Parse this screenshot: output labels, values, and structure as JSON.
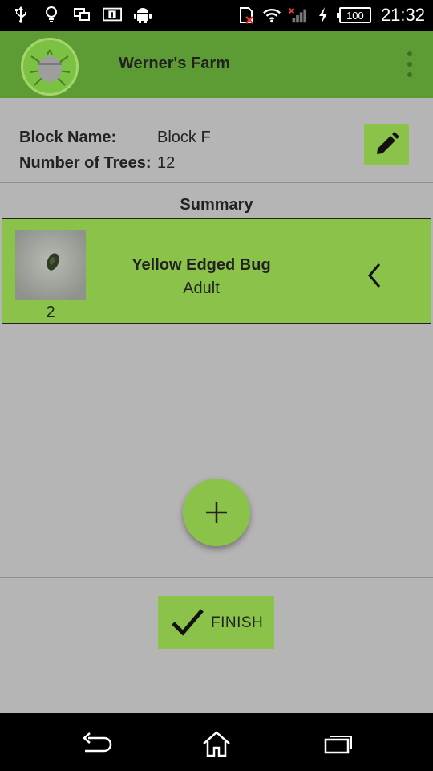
{
  "status_bar": {
    "time": "21:32",
    "battery": "100",
    "left_icons": [
      "usb-icon",
      "lightbulb-icon",
      "screen-mirror-icon",
      "info-icon",
      "android-icon"
    ],
    "right_icons": [
      "sim-missing-icon",
      "wifi-icon",
      "signal-icon",
      "charging-icon",
      "battery-icon"
    ]
  },
  "app_bar": {
    "title": "Werner's Farm",
    "logo_icon": "bug-logo-icon",
    "menu_icon": "overflow-menu-icon"
  },
  "block": {
    "name_label": "Block Name:",
    "name_value": "Block F",
    "trees_label": "Number of Trees:",
    "trees_value": "12",
    "edit_icon": "pencil-icon"
  },
  "summary": {
    "title": "Summary",
    "items": [
      {
        "bug_name": "Yellow Edged Bug",
        "stage": "Adult",
        "count": "2",
        "expand_icon": "chevron-left-icon"
      }
    ]
  },
  "fab": {
    "icon": "plus-icon"
  },
  "finish": {
    "label": "FINISH",
    "icon": "check-icon"
  },
  "nav_bar": {
    "icons": [
      "back-icon",
      "home-icon",
      "recent-apps-icon"
    ]
  },
  "colors": {
    "app_bar": "#5d9c35",
    "accent": "#8bc34a",
    "background": "#b5b5b5"
  }
}
